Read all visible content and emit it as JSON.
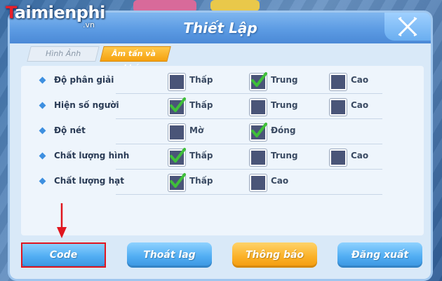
{
  "watermark": {
    "brand_prefix": "T",
    "brand_rest": "aimienphi",
    "tld": ".vn"
  },
  "dialog": {
    "title": "Thiết Lập"
  },
  "tabs": [
    {
      "label": "Hình Ảnh",
      "active": false
    },
    {
      "label": "Âm tấn và khác",
      "active": true
    }
  ],
  "settings": [
    {
      "label": "Độ phân giải",
      "options": [
        {
          "label": "Thấp",
          "checked": false
        },
        {
          "label": "Trung",
          "checked": true
        },
        {
          "label": "Cao",
          "checked": false
        }
      ]
    },
    {
      "label": "Hiện số người",
      "options": [
        {
          "label": "Thấp",
          "checked": true
        },
        {
          "label": "Trung",
          "checked": false
        },
        {
          "label": "Cao",
          "checked": false
        }
      ]
    },
    {
      "label": "Độ nét",
      "options": [
        {
          "label": "Mờ",
          "checked": false
        },
        {
          "label": "Đóng",
          "checked": true
        }
      ]
    },
    {
      "label": "Chất lượng hình",
      "options": [
        {
          "label": "Thấp",
          "checked": true
        },
        {
          "label": "Trung",
          "checked": false
        },
        {
          "label": "Cao",
          "checked": false
        }
      ]
    },
    {
      "label": "Chất lượng hạt",
      "options": [
        {
          "label": "Thấp",
          "checked": true
        },
        {
          "label": "Cao",
          "checked": false
        }
      ]
    }
  ],
  "buttons": [
    {
      "label": "Code",
      "style": "blue"
    },
    {
      "label": "Thoát lag",
      "style": "blue"
    },
    {
      "label": "Thông báo",
      "style": "orange"
    },
    {
      "label": "Đăng xuất",
      "style": "blue"
    }
  ],
  "colors": {
    "accent": "#5c9be3",
    "highlight": "#e0161f",
    "check": "#3fbf3a"
  }
}
